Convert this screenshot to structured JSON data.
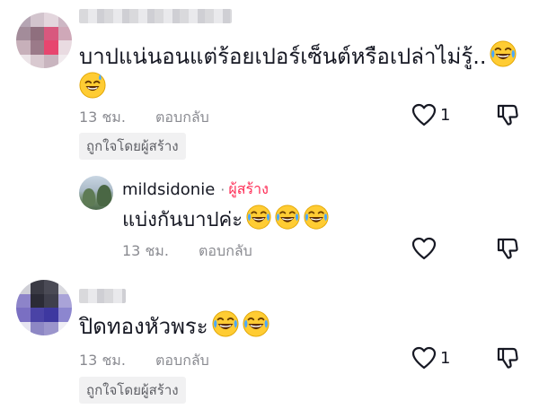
{
  "comments": [
    {
      "text": "บาปแน่นอนแต่ร้อยเปอร์เซ็นต์หรือเปล่าไม่รู้..",
      "emojis": [
        "grinning-sweat-emoji"
      ],
      "emoji_inline": "laughing-tears-emoji",
      "time": "13 ชม.",
      "reply_label": "ตอบกลับ",
      "like_count": "1",
      "liked_by_creator": "ถูกใจโดยผู้สร้าง"
    },
    {
      "text": "ปิดทองหัวพระ",
      "emoji_icons": [
        "laughing-tears-emoji",
        "laughing-tears-emoji"
      ],
      "time": "13 ชม.",
      "reply_label": "ตอบกลับ",
      "like_count": "1",
      "liked_by_creator": "ถูกใจโดยผู้สร้าง"
    }
  ],
  "reply": {
    "username": "mildsidonie",
    "separator": "·",
    "creator_badge": "ผู้สร้าง",
    "text": "แบ่งกันบาปค่ะ",
    "emoji_icons": [
      "laughing-tears-emoji",
      "laughing-tears-emoji",
      "laughing-tears-emoji"
    ],
    "time": "13 ชม.",
    "reply_label": "ตอบกลับ"
  },
  "colors": {
    "creator_accent": "#fe2c55",
    "meta_gray": "#8a8b91",
    "chip_bg": "#f1f1f2"
  }
}
